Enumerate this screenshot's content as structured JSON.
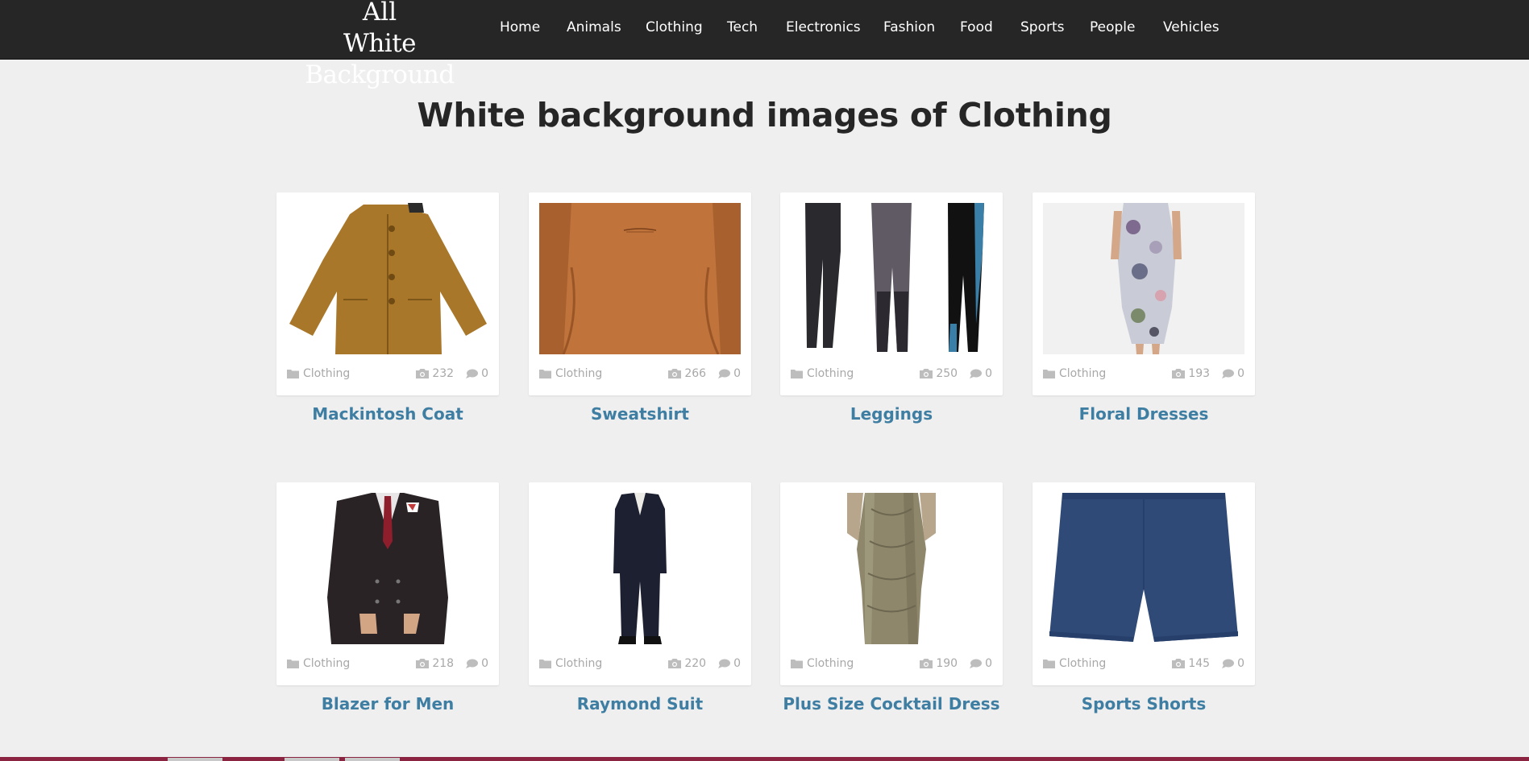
{
  "site": {
    "logo_line1": "All",
    "logo_line2": "White Background"
  },
  "nav": {
    "items": [
      {
        "label": "Home"
      },
      {
        "label": "Animals"
      },
      {
        "label": "Clothing"
      },
      {
        "label": "Tech"
      },
      {
        "label": "Electronics"
      },
      {
        "label": "Fashion"
      },
      {
        "label": "Food"
      },
      {
        "label": "Sports"
      },
      {
        "label": "People"
      },
      {
        "label": "Vehicles"
      }
    ]
  },
  "page": {
    "title": "White background images of Clothing"
  },
  "cards": [
    {
      "title": "Mackintosh Coat",
      "category": "Clothing",
      "photos": "232",
      "comments": "0"
    },
    {
      "title": "Sweatshirt",
      "category": "Clothing",
      "photos": "266",
      "comments": "0"
    },
    {
      "title": "Leggings",
      "category": "Clothing",
      "photos": "250",
      "comments": "0"
    },
    {
      "title": "Floral Dresses",
      "category": "Clothing",
      "photos": "193",
      "comments": "0"
    },
    {
      "title": "Blazer for Men",
      "category": "Clothing",
      "photos": "218",
      "comments": "0"
    },
    {
      "title": "Raymond Suit",
      "category": "Clothing",
      "photos": "220",
      "comments": "0"
    },
    {
      "title": "Plus Size Cocktail Dress",
      "category": "Clothing",
      "photos": "190",
      "comments": "0"
    },
    {
      "title": "Sports Shorts",
      "category": "Clothing",
      "photos": "145",
      "comments": "0"
    }
  ],
  "icons": {
    "category": "folder-icon",
    "photos": "camera-icon",
    "comments": "comment-icon"
  },
  "colors": {
    "navbar_bg": "#262626",
    "page_bg": "#efefef",
    "card_title": "#3f7ea3",
    "meta_text": "#a8a8a8"
  }
}
